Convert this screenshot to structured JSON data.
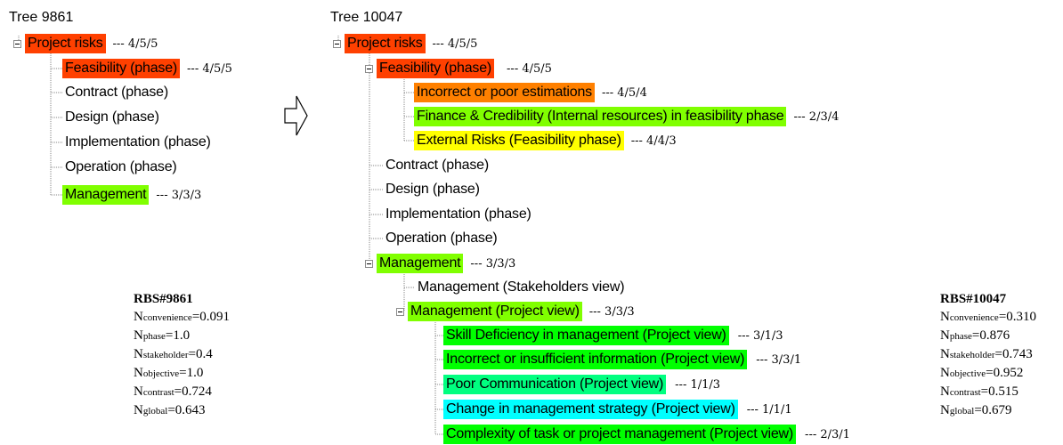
{
  "colors": {
    "risk_red": "#ff4000",
    "risk_orange": "#ff8000",
    "risk_lime": "#80ff00",
    "risk_green": "#00ff00",
    "risk_yellow": "#ffff00",
    "risk_teal": "#00ff80",
    "risk_cyan": "#00ffff",
    "tree_line": "#8a8a8a"
  },
  "tree_left": {
    "title": "Tree 9861",
    "nodes": [
      {
        "label": "Project risks",
        "score": "--- 4/5/5",
        "color": "#ff4000"
      },
      {
        "label": "Feasibility (phase)",
        "score": "--- 4/5/5",
        "color": "#ff4000"
      },
      {
        "label": "Contract (phase)",
        "score": "",
        "color": ""
      },
      {
        "label": "Design (phase)",
        "score": "",
        "color": ""
      },
      {
        "label": "Implementation (phase)",
        "score": "",
        "color": ""
      },
      {
        "label": "Operation (phase)",
        "score": "",
        "color": ""
      },
      {
        "label": "Management",
        "score": "--- 3/3/3",
        "color": "#80ff00"
      }
    ]
  },
  "tree_right": {
    "title": "Tree 10047",
    "nodes": [
      {
        "label": "Project risks",
        "score": "--- 4/5/5",
        "color": "#ff4000"
      },
      {
        "label": "Feasibility (phase)",
        "score": "--- 4/5/5",
        "color": "#ff4000"
      },
      {
        "label": "Incorrect or poor estimations",
        "score": "--- 4/5/4",
        "color": "#ff8000"
      },
      {
        "label": "Finance & Credibility (Internal resources) in feasibility phase",
        "score": "--- 2/3/4",
        "color": "#80ff00"
      },
      {
        "label": "External Risks (Feasibility phase)",
        "score": "--- 4/4/3",
        "color": "#ffff00"
      },
      {
        "label": "Contract (phase)",
        "score": "",
        "color": ""
      },
      {
        "label": "Design (phase)",
        "score": "",
        "color": ""
      },
      {
        "label": "Implementation (phase)",
        "score": "",
        "color": ""
      },
      {
        "label": "Operation (phase)",
        "score": "",
        "color": ""
      },
      {
        "label": "Management",
        "score": "--- 3/3/3",
        "color": "#80ff00"
      },
      {
        "label": "Management (Stakeholders view)",
        "score": "",
        "color": ""
      },
      {
        "label": "Management (Project view)",
        "score": "--- 3/3/3",
        "color": "#80ff00"
      },
      {
        "label": "Skill Deficiency in management (Project view)",
        "score": "--- 3/1/3",
        "color": "#00ff00"
      },
      {
        "label": "Incorrect or insufficient information (Project view)",
        "score": "--- 3/3/1",
        "color": "#00ff00"
      },
      {
        "label": "Poor Communication (Project view)",
        "score": "--- 1/1/3",
        "color": "#00ff80"
      },
      {
        "label": "Change in management strategy (Project view)",
        "score": "--- 1/1/1",
        "color": "#00ffff"
      },
      {
        "label": "Complexity of task or project management (Project view)",
        "score": "--- 2/3/1",
        "color": "#00ff00"
      }
    ]
  },
  "metrics_left": {
    "title": "RBS#9861",
    "rows": [
      {
        "sub": "convenience",
        "value": "=0.091"
      },
      {
        "sub": "phase",
        "value": "=1.0"
      },
      {
        "sub": "stakeholder",
        "value": "=0.4"
      },
      {
        "sub": "objective",
        "value": "=1.0"
      },
      {
        "sub": "contrast",
        "value": "=0.724"
      },
      {
        "sub": "global",
        "value": "=0.643"
      }
    ]
  },
  "metrics_right": {
    "title": "RBS#10047",
    "rows": [
      {
        "sub": "convenience",
        "value": "=0.310"
      },
      {
        "sub": "phase",
        "value": "=0.876"
      },
      {
        "sub": "stakeholder",
        "value": "=0.743"
      },
      {
        "sub": "objective",
        "value": "=0.952"
      },
      {
        "sub": "contrast",
        "value": "=0.515"
      },
      {
        "sub": "global",
        "value": "=0.679"
      }
    ]
  },
  "metric_letter": "N"
}
